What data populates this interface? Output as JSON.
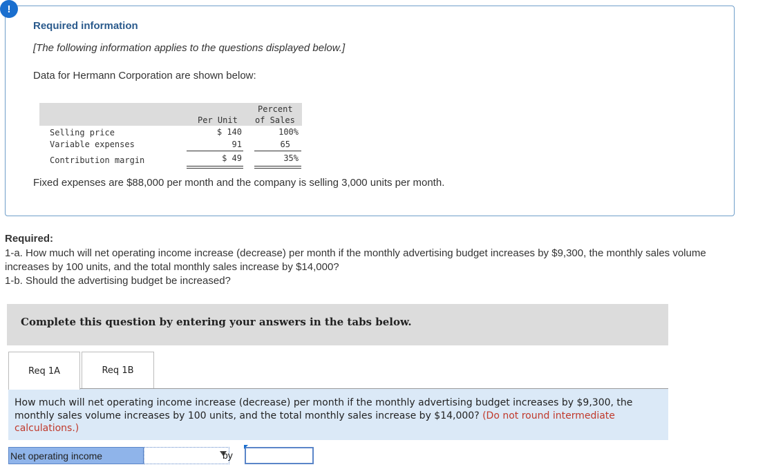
{
  "alert_glyph": "!",
  "info": {
    "title": "Required information",
    "note": "[The following information applies to the questions displayed below.]",
    "intro": "Data for Hermann Corporation are shown below:",
    "table": {
      "col_per_unit": "Per Unit",
      "col_percent_1": "Percent",
      "col_percent_2": "of Sales",
      "rows": [
        {
          "label": "Selling price",
          "per_unit": "$ 140",
          "percent": "100%"
        },
        {
          "label": "Variable expenses",
          "per_unit": "91",
          "percent": "65"
        },
        {
          "label": "Contribution margin",
          "per_unit": "$ 49",
          "percent": "35%"
        }
      ]
    },
    "fixed": "Fixed expenses are $88,000 per month and the company is selling 3,000 units per month."
  },
  "required": {
    "label": "Required:",
    "line_1a": "1-a. How much will net operating income increase (decrease) per month if the monthly advertising budget increases by $9,300, the monthly sales volume increases by 100 units, and the total monthly sales increase by $14,000?",
    "line_1b": "1-b. Should the advertising budget be increased?"
  },
  "instructions": "Complete this question by entering your answers in the tabs below.",
  "tabs": [
    {
      "label": "Req 1A",
      "active": true
    },
    {
      "label": "Req 1B",
      "active": false
    }
  ],
  "question": {
    "text": "How much will net operating income increase (decrease) per month if the monthly advertising budget increases by $9,300, the monthly sales volume increases by 100 units, and the total monthly sales increase by $14,000?",
    "hint": "(Do not round intermediate calculations.)"
  },
  "answer": {
    "label": "Net operating income",
    "select_value": "",
    "by": "by",
    "input_value": ""
  },
  "colors": {
    "accent": "#1a6fcf",
    "title_blue": "#2a5a8c",
    "hint_red": "#c0392b",
    "question_bg": "#dbe9f7",
    "label_bg": "#8fb4ea"
  }
}
